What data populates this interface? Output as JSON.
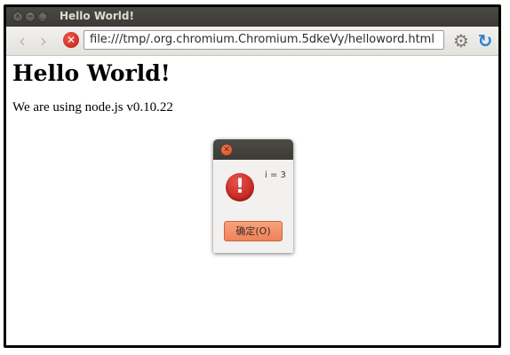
{
  "window": {
    "title": "Hello World!",
    "controls": {
      "close_glyph": "✕",
      "minimize_glyph": "−",
      "maximize_glyph": "□"
    }
  },
  "toolbar": {
    "back_glyph": "‹",
    "forward_glyph": "›",
    "stop_glyph": "✕",
    "address": "file:///tmp/.org.chromium.Chromium.5dkeVy/helloword.html",
    "tools_glyph": "⚙",
    "reload_glyph": "↻",
    "icons": [
      "back-icon",
      "forward-icon",
      "stop-icon",
      "gear-icon",
      "reload-icon"
    ]
  },
  "page": {
    "heading": "Hello World!",
    "text": "We are using node.js v0.10.22"
  },
  "dialog": {
    "close_glyph": "✕",
    "icon_glyph": "!",
    "icon": "error-icon",
    "message": "i = 3",
    "ok_label": "确定(O)"
  },
  "colors": {
    "titlebar": "#3c3b37",
    "dialog_button": "#ef8258",
    "stop_icon": "#c21b12",
    "reload_icon": "#2e7fd1"
  }
}
